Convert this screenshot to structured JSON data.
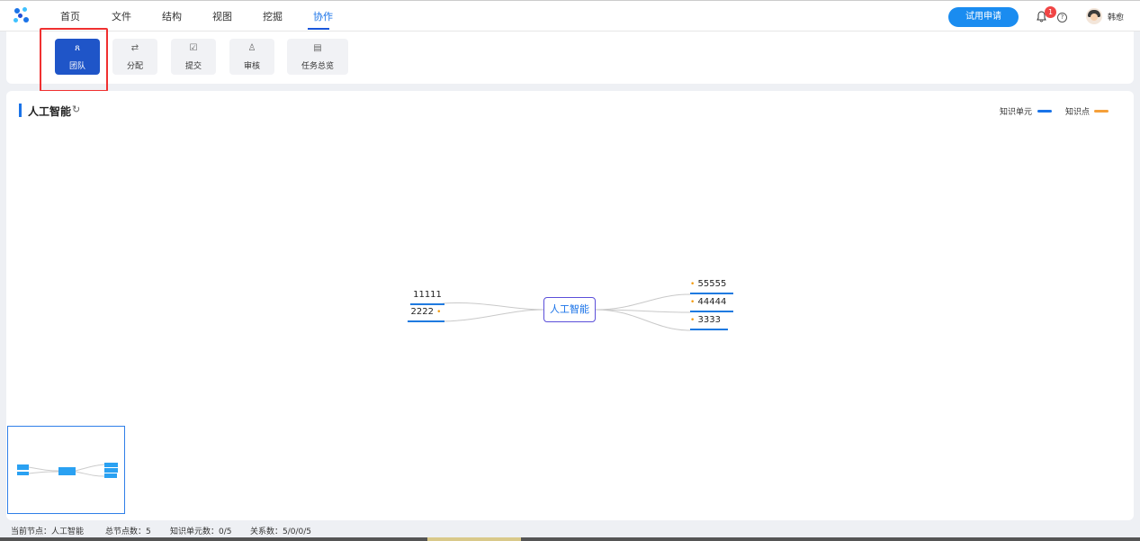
{
  "nav": {
    "items": [
      "首页",
      "文件",
      "结构",
      "视图",
      "挖掘",
      "协作"
    ],
    "active_index": 5,
    "trial_button": "试用申请",
    "notification_count": "1",
    "help_glyph": "?",
    "user_name": "韩愈"
  },
  "toolbar": {
    "tools": [
      {
        "label": "团队",
        "icon": "team-icon",
        "glyph": "ጸ"
      },
      {
        "label": "分配",
        "icon": "assign-icon",
        "glyph": "⇄"
      },
      {
        "label": "提交",
        "icon": "submit-check-icon",
        "glyph": "☑"
      },
      {
        "label": "审核",
        "icon": "review-icon",
        "glyph": "♙"
      },
      {
        "label": "任务总览",
        "icon": "task-overview-icon",
        "glyph": "▤"
      }
    ],
    "active_index": 0
  },
  "canvas": {
    "title": "人工智能",
    "title_icon": "↻",
    "legend": [
      {
        "label": "知识单元",
        "color": "#1a73e8"
      },
      {
        "label": "知识点",
        "color": "#f5a03a"
      }
    ],
    "center_node": "人工智能",
    "left_nodes": [
      "11111",
      "2222"
    ],
    "right_nodes": [
      "55555",
      "44444",
      "3333"
    ],
    "bullet": "•"
  },
  "status": {
    "current_node": "当前节点：人工智能",
    "total_nodes": "总节点数：5",
    "knowledge_units": "知识单元数：0/5",
    "relations": "关系数：5/0/0/5"
  },
  "colors": {
    "accent": "#1a73e8",
    "active_tool": "#1f55c8",
    "highlight": "#f03030",
    "knowledge_point": "#f39c12"
  }
}
